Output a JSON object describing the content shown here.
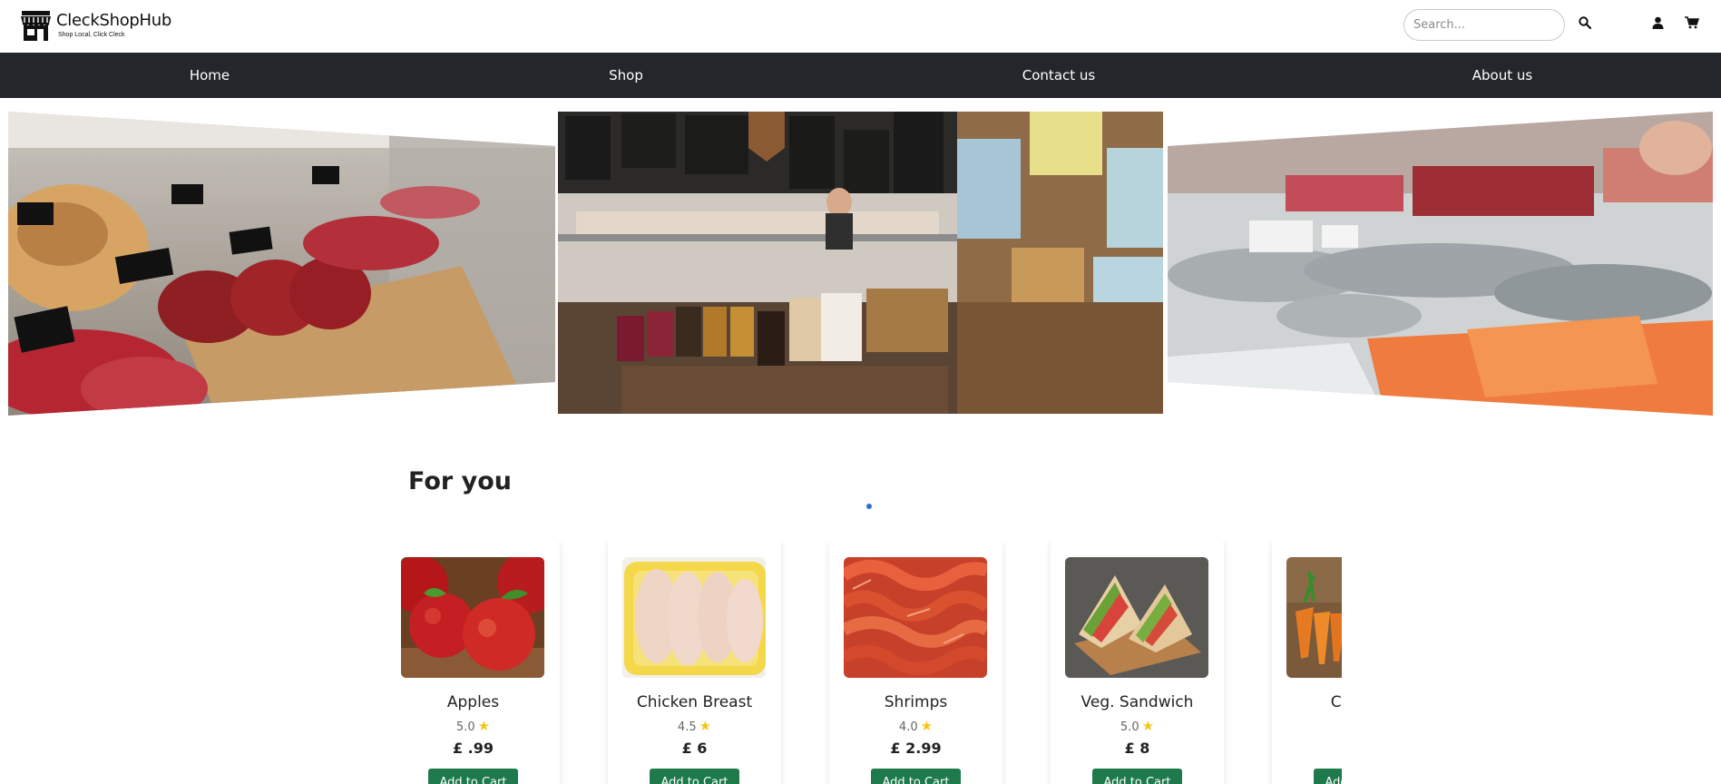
{
  "brand": {
    "name": "CleckShopHub",
    "tagline": "Shop Local, Click Cleck"
  },
  "search": {
    "placeholder": "Search..."
  },
  "header_icons": {
    "search": "search-icon",
    "account": "user-icon",
    "cart": "cart-icon"
  },
  "nav": {
    "items": [
      {
        "label": "Home"
      },
      {
        "label": "Shop"
      },
      {
        "label": "Contact us"
      },
      {
        "label": "About us"
      }
    ]
  },
  "carousel": {
    "slides": [
      {
        "subject": "butcher meat counter"
      },
      {
        "subject": "deli shop interior"
      },
      {
        "subject": "fishmonger counter"
      }
    ],
    "active_slide": 2
  },
  "section": {
    "title": "For you"
  },
  "products": [
    {
      "name": "Apples",
      "rating": "5.0",
      "price": "£ .99",
      "cta": "Add to Cart"
    },
    {
      "name": "Chicken Breast",
      "rating": "4.5",
      "price": "£ 6",
      "cta": "Add to Cart"
    },
    {
      "name": "Shrimps",
      "rating": "4.0",
      "price": "£ 2.99",
      "cta": "Add to Cart"
    },
    {
      "name": "Veg. Sandwich",
      "rating": "5.0",
      "price": "£ 8",
      "cta": "Add to Cart"
    },
    {
      "name": "Carrots",
      "rating": "",
      "price": "",
      "cta": "Add to Cart"
    }
  ],
  "colors": {
    "nav_bg": "#23272b",
    "button_green": "#1e7a4b",
    "star": "#f5c518"
  }
}
